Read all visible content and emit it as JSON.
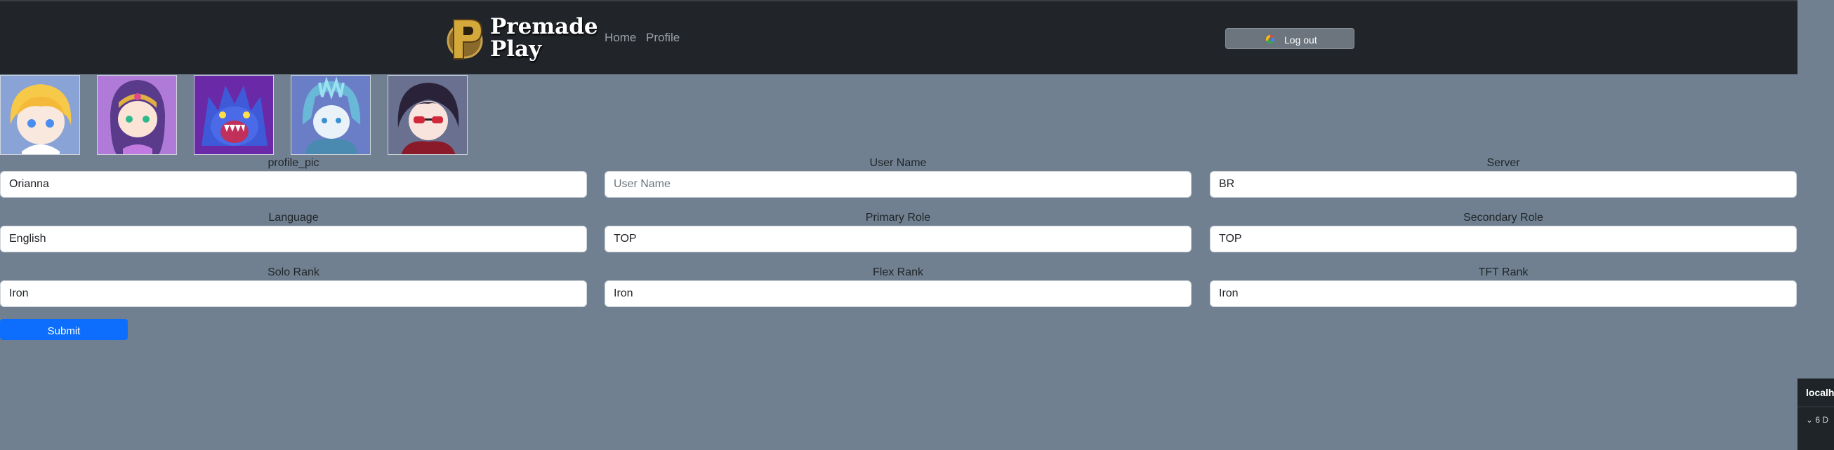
{
  "navbar": {
    "brand_line1": "Premade",
    "brand_line2": "Play",
    "links": {
      "home": "Home",
      "profile": "Profile"
    },
    "logout_label": "Log out"
  },
  "avatars": [
    "Lux",
    "Lillia",
    "Kog'Maw",
    "Sejuani",
    "Vayne"
  ],
  "form": {
    "fields": [
      {
        "label": "profile_pic",
        "value": "Orianna",
        "placeholder": ""
      },
      {
        "label": "User Name",
        "value": "",
        "placeholder": "User Name"
      },
      {
        "label": "Server",
        "value": "BR",
        "placeholder": ""
      },
      {
        "label": "Language",
        "value": "English",
        "placeholder": ""
      },
      {
        "label": "Primary Role",
        "value": "TOP",
        "placeholder": ""
      },
      {
        "label": "Secondary Role",
        "value": "TOP",
        "placeholder": ""
      },
      {
        "label": "Solo Rank",
        "value": "Iron",
        "placeholder": ""
      },
      {
        "label": "Flex Rank",
        "value": "Iron",
        "placeholder": ""
      },
      {
        "label": "TFT Rank",
        "value": "Iron",
        "placeholder": ""
      }
    ],
    "submit_label": "Submit"
  },
  "devtools": {
    "host": "localhost",
    "row": "6 D"
  },
  "colors": {
    "navbar": "#212529",
    "page": "#708090",
    "primary": "#0d6efd",
    "secondary": "#6c757d"
  }
}
